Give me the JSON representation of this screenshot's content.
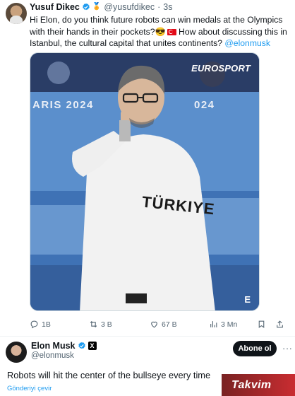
{
  "tweet1": {
    "author_name": "Yusuf Dikec",
    "handle": "@yusufdikec",
    "separator": "·",
    "time": "3s",
    "text_before": "Hi Elon, do you think future robots can win medals at the Olympics with their hands in their pockets?😎",
    "text_after": " How about discussing this in Istanbul, the cultural capital that unites continents? ",
    "mention": "@elonmusk",
    "media": {
      "watermark": "EUROSPORT",
      "background_text_left": "ARIS 2024",
      "background_text_right": "024",
      "shirt_text": "TÜRKIYE",
      "corner_logo": "E"
    },
    "actions": {
      "replies": "1B",
      "retweets": "3 B",
      "likes": "67 B",
      "views": "3 Mn"
    }
  },
  "tweet2": {
    "author_name": "Elon Musk",
    "handle": "@elonmusk",
    "badge": "X",
    "follow_label": "Abone ol",
    "more": "···",
    "text": "Robots will hit the center of the bullseye every time",
    "translate": "Gönderiyi çevir"
  },
  "brand": {
    "text": "Takvim"
  },
  "colors": {
    "accent": "#1d9bf0",
    "text": "#0f1419",
    "muted": "#536471",
    "button_bg": "#0f1419",
    "brand_red": "#c3151a"
  }
}
